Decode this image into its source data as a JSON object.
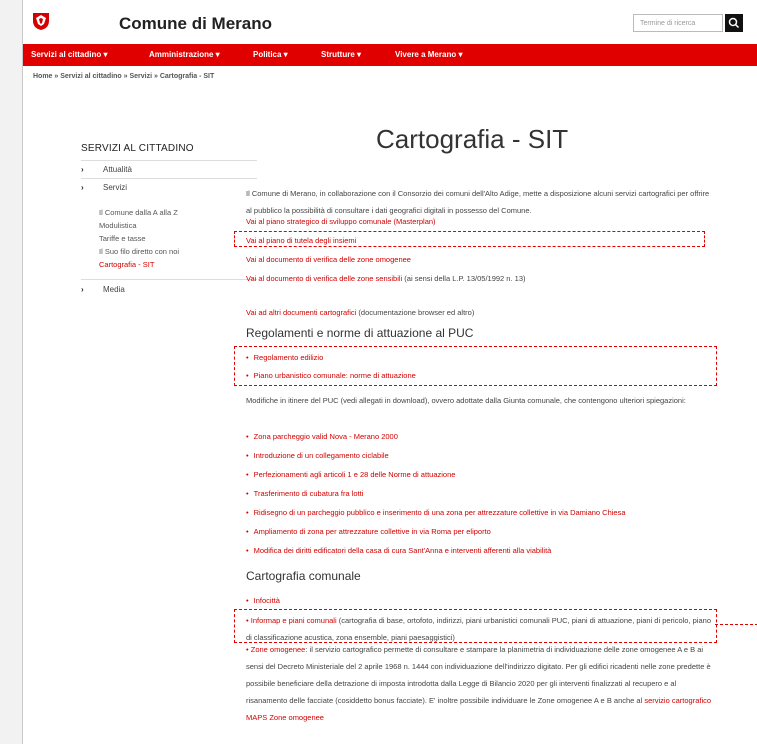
{
  "header": {
    "site_title": "Comune di Merano",
    "search_placeholder": "Termine di ricerca"
  },
  "nav": {
    "items": [
      "Servizi al cittadino ▾",
      "Amministrazione ▾",
      "Politica ▾",
      "Strutture ▾",
      "Vivere a Merano ▾"
    ]
  },
  "breadcrumb": "Home » Servizi al cittadino » Servizi » Cartografia - SIT",
  "sidebar": {
    "title": "SERVIZI AL CITTADINO",
    "items": [
      "Attualità",
      "Servizi",
      "Media"
    ],
    "subitems": [
      "Il Comune dalla A alla Z",
      "Modulistica",
      "Tariffe e tasse",
      "Il Suo filo diretto con noi",
      "Cartografia - SIT"
    ]
  },
  "main": {
    "title": "Cartografia - SIT",
    "intro": "Il Comune di Merano, in collaborazione con il Consorzio dei comuni dell'Alto Adige, mette a disposizione alcuni servizi cartografici per offrire al pubblico la possibilità di consultare i dati geografici digitali in possesso del Comune.",
    "links": [
      "Vai al piano strategico di sviluppo comunale (Masterplan)",
      "Vai al piano di tutela degli insiemi",
      "Vai al documento di verifica delle zone omogenee",
      "Vai al documento di verifica delle zone sensibili"
    ],
    "link4_suffix": " (ai sensi della L.P. 13/05/1992 n. 13)",
    "other_docs_link": "Vai ad altri documenti cartografici",
    "other_docs_suffix": " (documentazione browser ed altro)",
    "section1_title": "Regolamenti e norme di attuazione al PUC",
    "section1_items": [
      "Regolamento edilizio",
      "Piano urbanistico comunale: norme di attuazione"
    ],
    "modifiche_text": "Modifiche in itinere del PUC (vedi allegati in download), ovvero adottate dalla Giunta comunale, che contengono ulteriori spiegazioni:",
    "modifiche_items": [
      "Zona parcheggio valid Nova - Merano 2000",
      "Introduzione di un collegamento ciclabile",
      "Perfezionamenti agli articoli 1 e 28 delle Norme di attuazione",
      "Trasferimento di cubatura fra lotti",
      "Ridisegno di un parcheggio pubblico e inserimento di una zona per attrezzature collettive in via Damiano Chiesa",
      "Ampliamento di zona per attrezzature collettive in via Roma per eliporto",
      "Modifica dei diritti edificatori della casa di cura Sant'Anna e interventi afferenti alla viabilità"
    ],
    "section2_title": "Cartografia comunale",
    "carto_items": [
      "Infocittà",
      "Informap e piani comunali"
    ],
    "informap_text": " (cartografia di base, ortofoto, indirizzi, piani urbanistici comunali PUC, piani di attuazione, piani di pericolo, piano di classificazione acustica, zona ensemble, piani paesaggistici)",
    "zone_link": "Zone omogenee",
    "zone_text": ": il servizio cartografico permette di consultare e stampare la planimetria di individuazione delle zone omogenee A e B ai sensi del Decreto Ministeriale del 2 aprile 1968 n. 1444 con individuazione dell'indirizzo digitato. Per gli edifici ricadenti nelle zone predette è possibile beneficiare della detrazione di imposta introdotta dalla Legge di Bilancio 2020 per gli interventi finalizzati al recupero e al risanamento delle facciate (cosiddetto bonus facciate). E' inoltre possibile individuare le Zone omogenee A e B anche al ",
    "zone_link2": "servizio cartografico MAPS Zone omogenee"
  },
  "colors": {
    "accent": "#e00000"
  }
}
